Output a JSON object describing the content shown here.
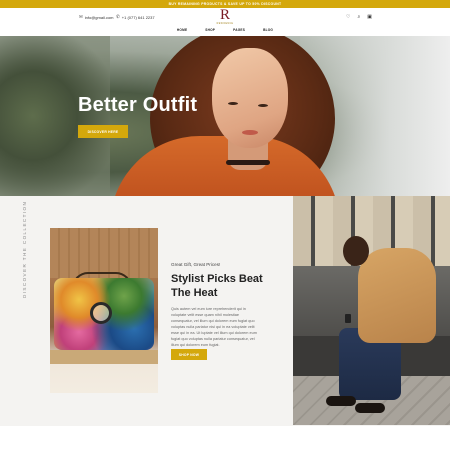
{
  "announcement": {
    "text": "BUY REMAINING PRODUCTS & SAVE UP TO 50% DISCOUNT"
  },
  "header": {
    "email": "info@gmail.com",
    "phone": "+1 (077) 641 2237",
    "logo_mark": "R",
    "logo_sub": "RESIDENCE",
    "nav": [
      "HOME",
      "SHOP",
      "PAGES",
      "BLOG"
    ],
    "icons": [
      "heart-icon",
      "search-icon",
      "bag-icon"
    ]
  },
  "hero": {
    "title": "Better Outfit",
    "button_label": "DISCOVER HERE"
  },
  "feature": {
    "vertical_label": "DISCOVER THE COLLECTION",
    "subtitle": "Great Gift, Great Prices!",
    "title": "Stylist Picks Beat The Heat",
    "body": "Quis autem vel eum iure reprehenderit qui in voluptate velit esse quam nihil molestiae consequatur, vel illum qui dolorem eum fugiat quo voluptas nulla pariatur nisi qui in ea voluptate velit esse qui in ea. Ut luptate vel illum qui dolorem eum fugiat quo voluptas nulla pariatur consequatur, vel illum qui dolorem eum fugiat.",
    "button_label": "SHOP NOW"
  },
  "colors": {
    "accent": "#d4a80c",
    "logo": "#7a1a22",
    "section_bg": "#f4f3f1"
  }
}
